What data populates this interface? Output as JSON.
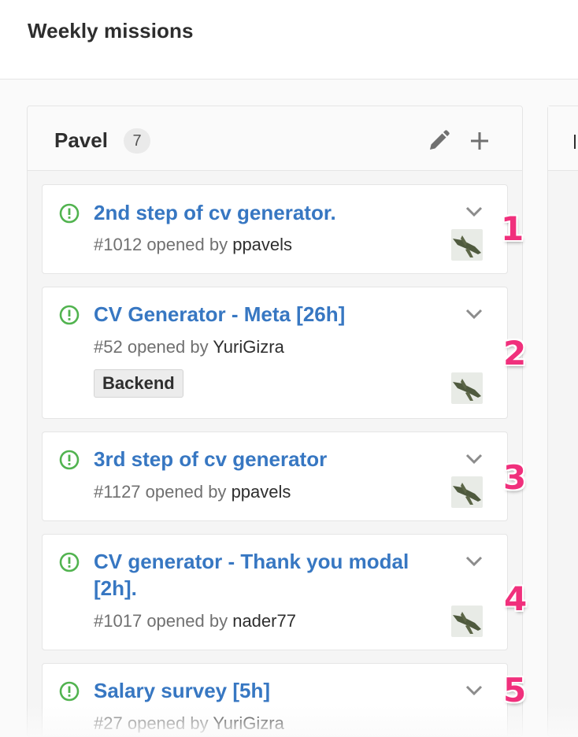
{
  "page": {
    "title": "Weekly missions"
  },
  "list": {
    "title": "Pavel",
    "count": "7"
  },
  "cards": [
    {
      "title": "2nd step of cv generator.",
      "number": "#1012",
      "opened_by": "opened by",
      "author": "ppavels",
      "step": "1"
    },
    {
      "title": "CV Generator - Meta [26h]",
      "number": "#52",
      "opened_by": "opened by",
      "author": "YuriGizra",
      "label": "Backend",
      "step": "2"
    },
    {
      "title": "3rd step of cv generator",
      "number": "#1127",
      "opened_by": "opened by",
      "author": "ppavels",
      "step": "3"
    },
    {
      "title": "CV generator - Thank you modal [2h].",
      "number": "#1017",
      "opened_by": "opened by",
      "author": "nader77",
      "step": "4"
    },
    {
      "title": "Salary survey [5h]",
      "number": "#27",
      "opened_by": "opened by",
      "author": "YuriGizra",
      "step": "5"
    }
  ],
  "colors": {
    "issue_open": "#51b34f",
    "link": "#3777c2",
    "step_marker": "#f0307c"
  },
  "icons": {
    "issue": "issue-open-icon",
    "edit": "pencil-icon",
    "add": "plus-icon",
    "expand": "chevron-down-icon"
  }
}
